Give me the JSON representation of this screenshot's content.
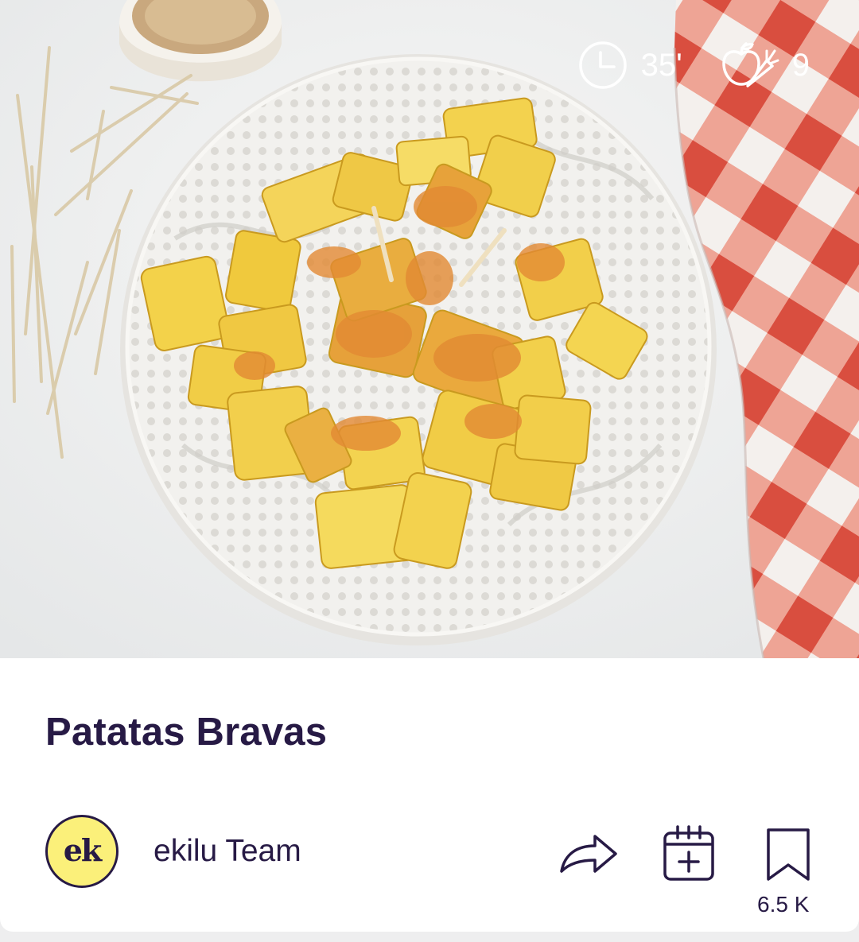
{
  "recipe": {
    "title": "Patatas Bravas",
    "time": "35'",
    "ingredients_count": "9"
  },
  "author": {
    "avatar_text": "ek",
    "name": "ekilu Team"
  },
  "actions": {
    "save_count": "6.5 K"
  },
  "icons": {
    "time": "clock-icon",
    "ingredients": "apple-carrot-icon",
    "share": "share-arrow-icon",
    "plan": "calendar-add-icon",
    "save": "bookmark-icon"
  },
  "colors": {
    "title": "#271a45",
    "avatar_bg": "#fbf07a",
    "meta_text": "#ffffff"
  }
}
